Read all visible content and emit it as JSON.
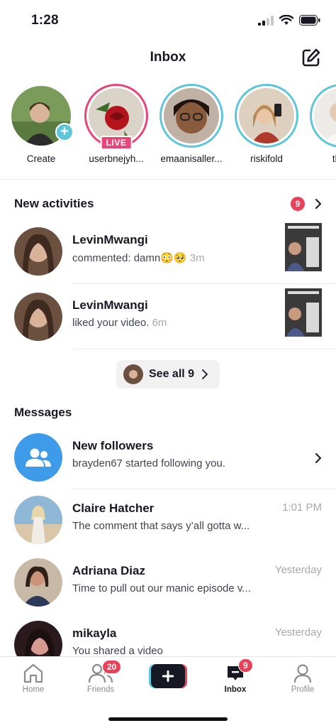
{
  "status_bar": {
    "time": "1:28"
  },
  "header": {
    "title": "Inbox"
  },
  "stories": [
    {
      "name": "Create",
      "ring": "none",
      "badge": "plus"
    },
    {
      "name": "userbnejyh...",
      "ring": "live",
      "badge": "LIVE"
    },
    {
      "name": "emaanisaller...",
      "ring": "blue",
      "badge": ""
    },
    {
      "name": "riskifold",
      "ring": "blue",
      "badge": ""
    },
    {
      "name": "theo",
      "ring": "blue",
      "badge": ""
    }
  ],
  "activities": {
    "title": "New activities",
    "count": "9",
    "items": [
      {
        "user": "LevinMwangi",
        "text": "commented: damn😳🥺",
        "time": "3m"
      },
      {
        "user": "LevinMwangi",
        "text": "liked your video.",
        "time": "6m"
      }
    ],
    "see_all_label": "See all 9"
  },
  "messages": {
    "title": "Messages",
    "items": [
      {
        "name": "New followers",
        "preview": "brayden67 started following you.",
        "time": ""
      },
      {
        "name": "Claire Hatcher",
        "preview": "The comment that says y’all gotta w...",
        "time": "1:01 PM"
      },
      {
        "name": "Adriana Diaz",
        "preview": "Time to pull out our manic episode v...",
        "time": "Yesterday"
      },
      {
        "name": "mikayla",
        "preview": "You shared a video",
        "time": "Yesterday"
      }
    ]
  },
  "tabbar": {
    "home": "Home",
    "friends": "Friends",
    "friends_badge": "20",
    "inbox": "Inbox",
    "inbox_badge": "9",
    "profile": "Profile"
  },
  "colors": {
    "accent_red": "#e8415a",
    "story_blue": "#5ec6d8",
    "live_pink": "#e8457a",
    "follower_blue": "#3d9be9"
  }
}
